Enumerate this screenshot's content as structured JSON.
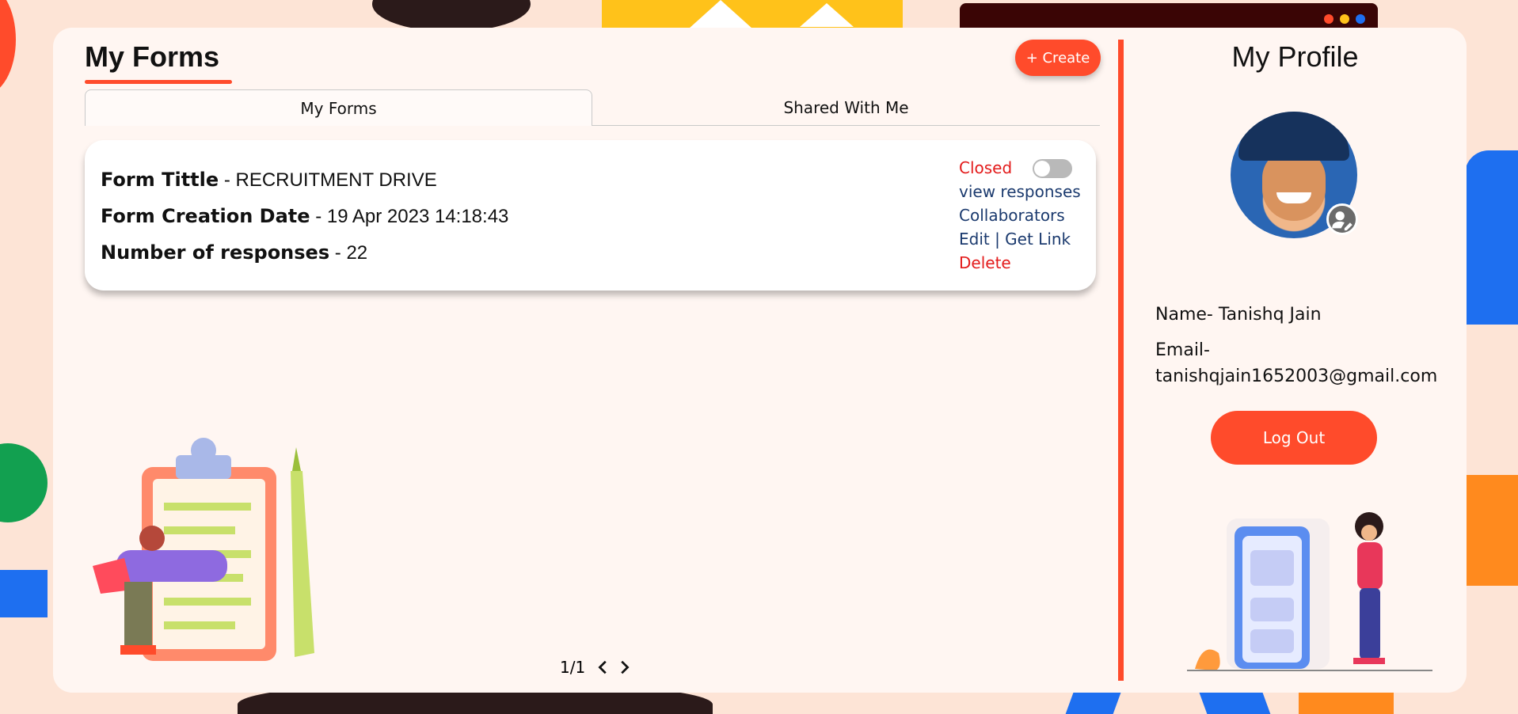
{
  "colors": {
    "accent": "#ff4b2b",
    "link": "#1b3a6e",
    "danger": "#e31b1b",
    "card": "#fff6f2"
  },
  "forms": {
    "title": "My Forms",
    "create_label": "+ Create",
    "tabs": [
      {
        "label": "My Forms",
        "active": true
      },
      {
        "label": "Shared With Me",
        "active": false
      }
    ],
    "items": [
      {
        "title_label": "Form Tittle",
        "title_value": " - RECRUITMENT DRIVE",
        "date_label": "Form Creation Date",
        "date_value": " - 19 Apr 2023 14:18:43",
        "responses_label": "Number of responses",
        "responses_value": " - 22",
        "status": "Closed",
        "accepting_responses": false,
        "actions": {
          "view_responses": "view responses",
          "collaborators": "Collaborators",
          "edit_link": "Edit | Get Link",
          "delete": "Delete"
        }
      }
    ],
    "pagination": {
      "label": "1/1"
    }
  },
  "profile": {
    "title": "My Profile",
    "name_line": "Name- Tanishq Jain",
    "email_label": "Email-",
    "email_value": "tanishqjain1652003@gmail.com",
    "logout_label": "Log Out"
  },
  "icons": {
    "prev": "chevron-left-icon",
    "next": "chevron-right-icon",
    "edit_avatar": "user-edit-icon"
  }
}
